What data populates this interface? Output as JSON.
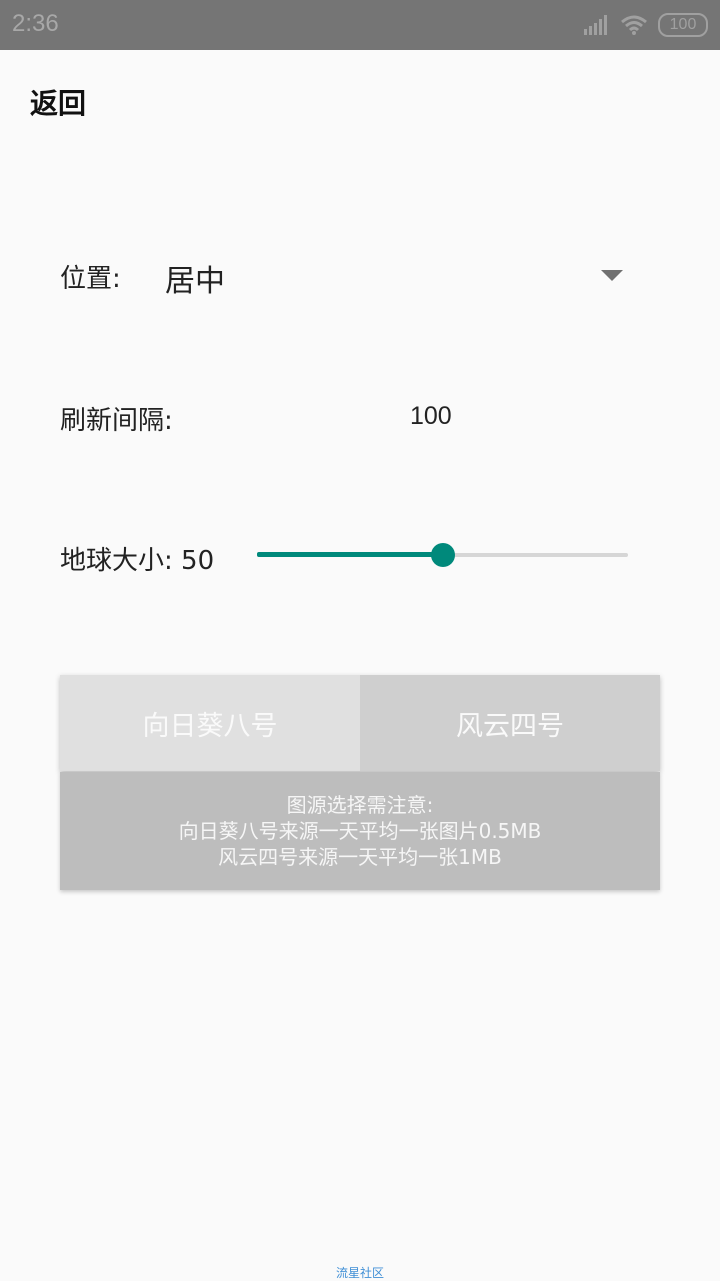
{
  "status_bar": {
    "time": "2:36",
    "battery": "100",
    "icons": [
      "signal-icon",
      "wifi-icon",
      "battery-icon"
    ]
  },
  "header": {
    "back_label": "返回"
  },
  "settings": {
    "position": {
      "label": "位置:",
      "value": "居中"
    },
    "refresh": {
      "label": "刷新间隔:",
      "value": "100"
    },
    "globe_size": {
      "label": "地球大小: 50",
      "value": 50,
      "min": 0,
      "max": 100
    }
  },
  "source_tabs": {
    "items": [
      {
        "label": "向日葵八号"
      },
      {
        "label": "风云四号"
      }
    ]
  },
  "note": {
    "line1": "图源选择需注意:",
    "line2": "向日葵八号来源一天平均一张图片0.5MB",
    "line3": "风云四号来源一天平均一张1MB"
  },
  "footer": {
    "text": "流星社区"
  },
  "colors": {
    "accent": "#00897b",
    "status_bar": "#757575",
    "note_bg": "#bdbdbd",
    "footer_link": "#3f8fd6"
  }
}
